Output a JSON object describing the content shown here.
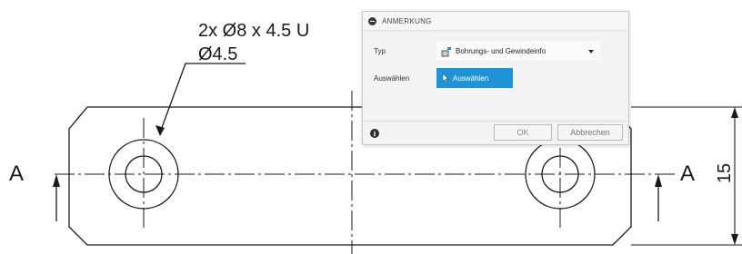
{
  "drawing": {
    "hole_note_line1": "2x Ø8 x 4.5 U",
    "hole_note_line2": "Ø4.5",
    "section_left": "A",
    "section_right": "A",
    "dimension_height": "15"
  },
  "dialog": {
    "title": "ANMERKUNG",
    "type_label": "Typ",
    "type_value": "Bohrungs- und Gewindeinfo",
    "select_label": "Auswählen",
    "select_button": "Auswählen",
    "ok_label": "OK",
    "cancel_label": "Abbrechen",
    "info_glyph": "i"
  },
  "icons": {
    "header": "collapse-minus-icon",
    "type": "hole-thread-note-icon",
    "select": "cursor-arrow-icon",
    "info": "info-icon"
  },
  "colors": {
    "accent": "#1e94d6",
    "line": "#1a1a1a",
    "dialog_bg": "#f3f3f3"
  }
}
